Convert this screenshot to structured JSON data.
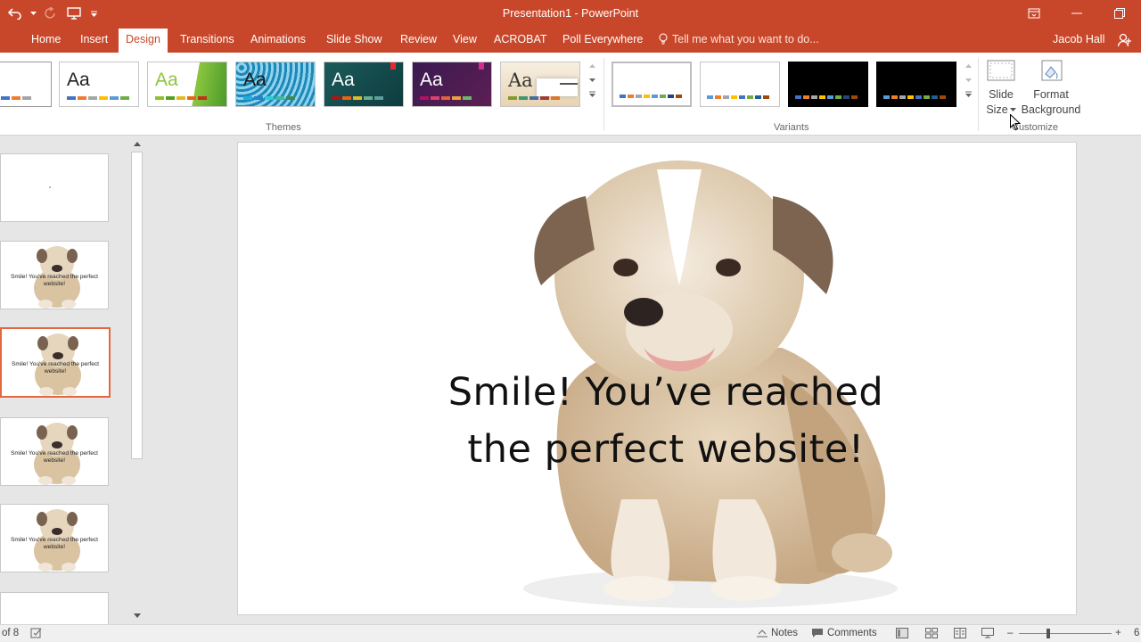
{
  "titlebar": {
    "title": "Presentation1 - PowerPoint"
  },
  "tabs": [
    {
      "label": "Home"
    },
    {
      "label": "Insert"
    },
    {
      "label": "Design"
    },
    {
      "label": "Transitions"
    },
    {
      "label": "Animations"
    },
    {
      "label": "Slide Show"
    },
    {
      "label": "Review"
    },
    {
      "label": "View"
    },
    {
      "label": "ACROBAT"
    },
    {
      "label": "Poll Everywhere"
    }
  ],
  "tell_me": "Tell me what you want to do...",
  "user": "Jacob Hall",
  "themes": {
    "label": "Themes",
    "items": [
      {
        "text": "Aa",
        "name": "office"
      },
      {
        "text": "Aa",
        "name": "facet"
      },
      {
        "text": "Aa",
        "name": "integral"
      },
      {
        "text": "Aa",
        "name": "ion"
      },
      {
        "text": "Aa",
        "name": "ion-boardroom"
      },
      {
        "text": "Aa",
        "name": "organic"
      }
    ]
  },
  "variants": {
    "label": "Variants"
  },
  "customize": {
    "label": "Customize",
    "slide_size_line1": "Slide",
    "slide_size_line2": "Size",
    "format_bg_line1": "Format",
    "format_bg_line2": "Background"
  },
  "thumbnails": [
    {
      "text": ""
    },
    {
      "text": "Smile! You've reached the perfect website!"
    },
    {
      "text": "Smile! You've reached the perfect website!"
    },
    {
      "text": "Smile! You've reached the perfect website!"
    },
    {
      "text": "Smile! You've reached the perfect website!"
    }
  ],
  "slide": {
    "line1": "Smile! You’ve reached",
    "line2": "the perfect website!"
  },
  "status": {
    "slide_counter": "of 8",
    "notes": "Notes",
    "comments": "Comments",
    "zoom_minus": "–",
    "zoom_plus": "+",
    "zoom_level_partial": "6"
  },
  "colors": {
    "accent": "#c8472a",
    "selected_border": "#e3673f"
  }
}
